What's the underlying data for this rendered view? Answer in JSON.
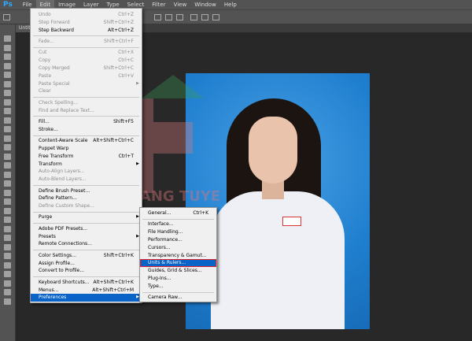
{
  "app": {
    "logo": "Ps"
  },
  "menubar": [
    "File",
    "Edit",
    "Image",
    "Layer",
    "Type",
    "Select",
    "Filter",
    "View",
    "Window",
    "Help"
  ],
  "active_menu": "Edit",
  "document_tab": "Untitl",
  "watermark": "HOANG TUYEN",
  "edit_menu": [
    {
      "label": "Undo",
      "shortcut": "Ctrl+Z",
      "disabled": true
    },
    {
      "label": "Step Forward",
      "shortcut": "Shift+Ctrl+Z",
      "disabled": true
    },
    {
      "label": "Step Backward",
      "shortcut": "Alt+Ctrl+Z"
    },
    {
      "sep": true
    },
    {
      "label": "Fade...",
      "shortcut": "Shift+Ctrl+F",
      "disabled": true
    },
    {
      "sep": true
    },
    {
      "label": "Cut",
      "shortcut": "Ctrl+X",
      "disabled": true
    },
    {
      "label": "Copy",
      "shortcut": "Ctrl+C",
      "disabled": true
    },
    {
      "label": "Copy Merged",
      "shortcut": "Shift+Ctrl+C",
      "disabled": true
    },
    {
      "label": "Paste",
      "shortcut": "Ctrl+V",
      "disabled": true
    },
    {
      "label": "Paste Special",
      "submenu": true,
      "disabled": true
    },
    {
      "label": "Clear",
      "disabled": true
    },
    {
      "sep": true
    },
    {
      "label": "Check Spelling...",
      "disabled": true
    },
    {
      "label": "Find and Replace Text...",
      "disabled": true
    },
    {
      "sep": true
    },
    {
      "label": "Fill...",
      "shortcut": "Shift+F5"
    },
    {
      "label": "Stroke..."
    },
    {
      "sep": true
    },
    {
      "label": "Content-Aware Scale",
      "shortcut": "Alt+Shift+Ctrl+C"
    },
    {
      "label": "Puppet Warp"
    },
    {
      "label": "Free Transform",
      "shortcut": "Ctrl+T"
    },
    {
      "label": "Transform",
      "submenu": true
    },
    {
      "label": "Auto-Align Layers...",
      "disabled": true
    },
    {
      "label": "Auto-Blend Layers...",
      "disabled": true
    },
    {
      "sep": true
    },
    {
      "label": "Define Brush Preset..."
    },
    {
      "label": "Define Pattern..."
    },
    {
      "label": "Define Custom Shape...",
      "disabled": true
    },
    {
      "sep": true
    },
    {
      "label": "Purge",
      "submenu": true
    },
    {
      "sep": true
    },
    {
      "label": "Adobe PDF Presets..."
    },
    {
      "label": "Presets",
      "submenu": true
    },
    {
      "label": "Remote Connections..."
    },
    {
      "sep": true
    },
    {
      "label": "Color Settings...",
      "shortcut": "Shift+Ctrl+K"
    },
    {
      "label": "Assign Profile..."
    },
    {
      "label": "Convert to Profile..."
    },
    {
      "sep": true
    },
    {
      "label": "Keyboard Shortcuts...",
      "shortcut": "Alt+Shift+Ctrl+K"
    },
    {
      "label": "Menus...",
      "shortcut": "Alt+Shift+Ctrl+M"
    },
    {
      "label": "Preferences",
      "submenu": true,
      "highlighted": true
    }
  ],
  "preferences_menu": [
    {
      "label": "General...",
      "shortcut": "Ctrl+K"
    },
    {
      "sep": true
    },
    {
      "label": "Interface..."
    },
    {
      "label": "File Handling..."
    },
    {
      "label": "Performance..."
    },
    {
      "label": "Cursors..."
    },
    {
      "label": "Transparency & Gamut..."
    },
    {
      "label": "Units & Rulers...",
      "highlighted": true,
      "boxed": true
    },
    {
      "label": "Guides, Grid & Slices..."
    },
    {
      "label": "Plug-Ins..."
    },
    {
      "label": "Type..."
    },
    {
      "sep": true
    },
    {
      "label": "Camera Raw..."
    }
  ],
  "colors": {
    "highlight": "#0a64c8",
    "callout": "#e0202a",
    "photo_bg": "#1f7fcf"
  }
}
